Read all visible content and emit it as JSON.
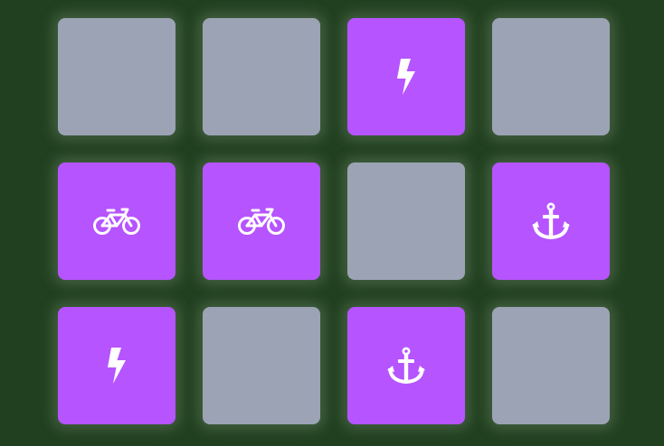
{
  "colors": {
    "background": "#214020",
    "card_hidden": "#9ca3b4",
    "card_revealed": "#b654ff",
    "icon": "#ffffff"
  },
  "board": {
    "rows": 3,
    "columns": 4,
    "cards": [
      {
        "state": "hidden",
        "icon": ""
      },
      {
        "state": "hidden",
        "icon": ""
      },
      {
        "state": "revealed",
        "icon": "lightning-bolt-icon"
      },
      {
        "state": "hidden",
        "icon": ""
      },
      {
        "state": "revealed",
        "icon": "bicycle-icon"
      },
      {
        "state": "revealed",
        "icon": "bicycle-icon"
      },
      {
        "state": "hidden",
        "icon": ""
      },
      {
        "state": "revealed",
        "icon": "anchor-icon"
      },
      {
        "state": "revealed",
        "icon": "lightning-bolt-icon"
      },
      {
        "state": "hidden",
        "icon": ""
      },
      {
        "state": "revealed",
        "icon": "anchor-icon"
      },
      {
        "state": "hidden",
        "icon": ""
      }
    ]
  }
}
